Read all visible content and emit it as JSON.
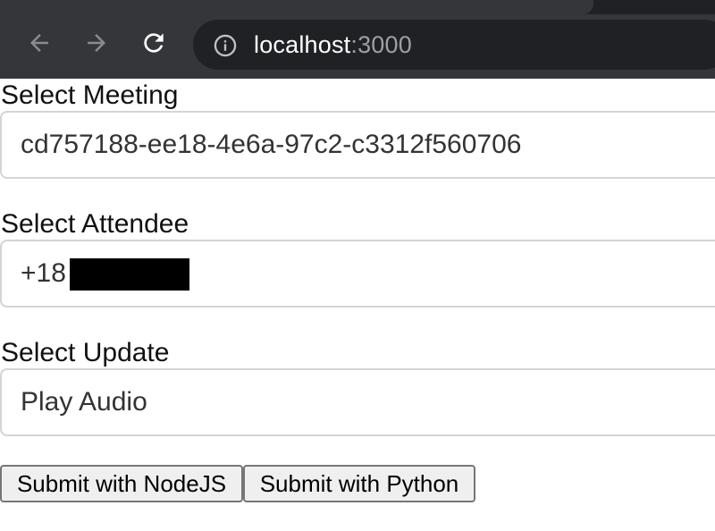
{
  "browser": {
    "url_host": "localhost",
    "url_port": ":3000",
    "icons": {
      "back": "back-arrow-icon",
      "forward": "forward-arrow-icon",
      "reload": "reload-icon",
      "site_info": "info-icon"
    },
    "colors": {
      "toolbar": "#35363a",
      "omnibox": "#202124",
      "url_host_text": "#ffffff",
      "url_port_text": "#9aa0a6"
    }
  },
  "form": {
    "meeting": {
      "label": "Select Meeting",
      "value": "cd757188-ee18-4e6a-97c2-c3312f560706"
    },
    "attendee": {
      "label": "Select Attendee",
      "value": "+18          45"
    },
    "update": {
      "label": "Select Update",
      "value": "Play Audio"
    }
  },
  "buttons": {
    "submit_node": "Submit with NodeJS",
    "submit_python": "Submit with Python"
  }
}
